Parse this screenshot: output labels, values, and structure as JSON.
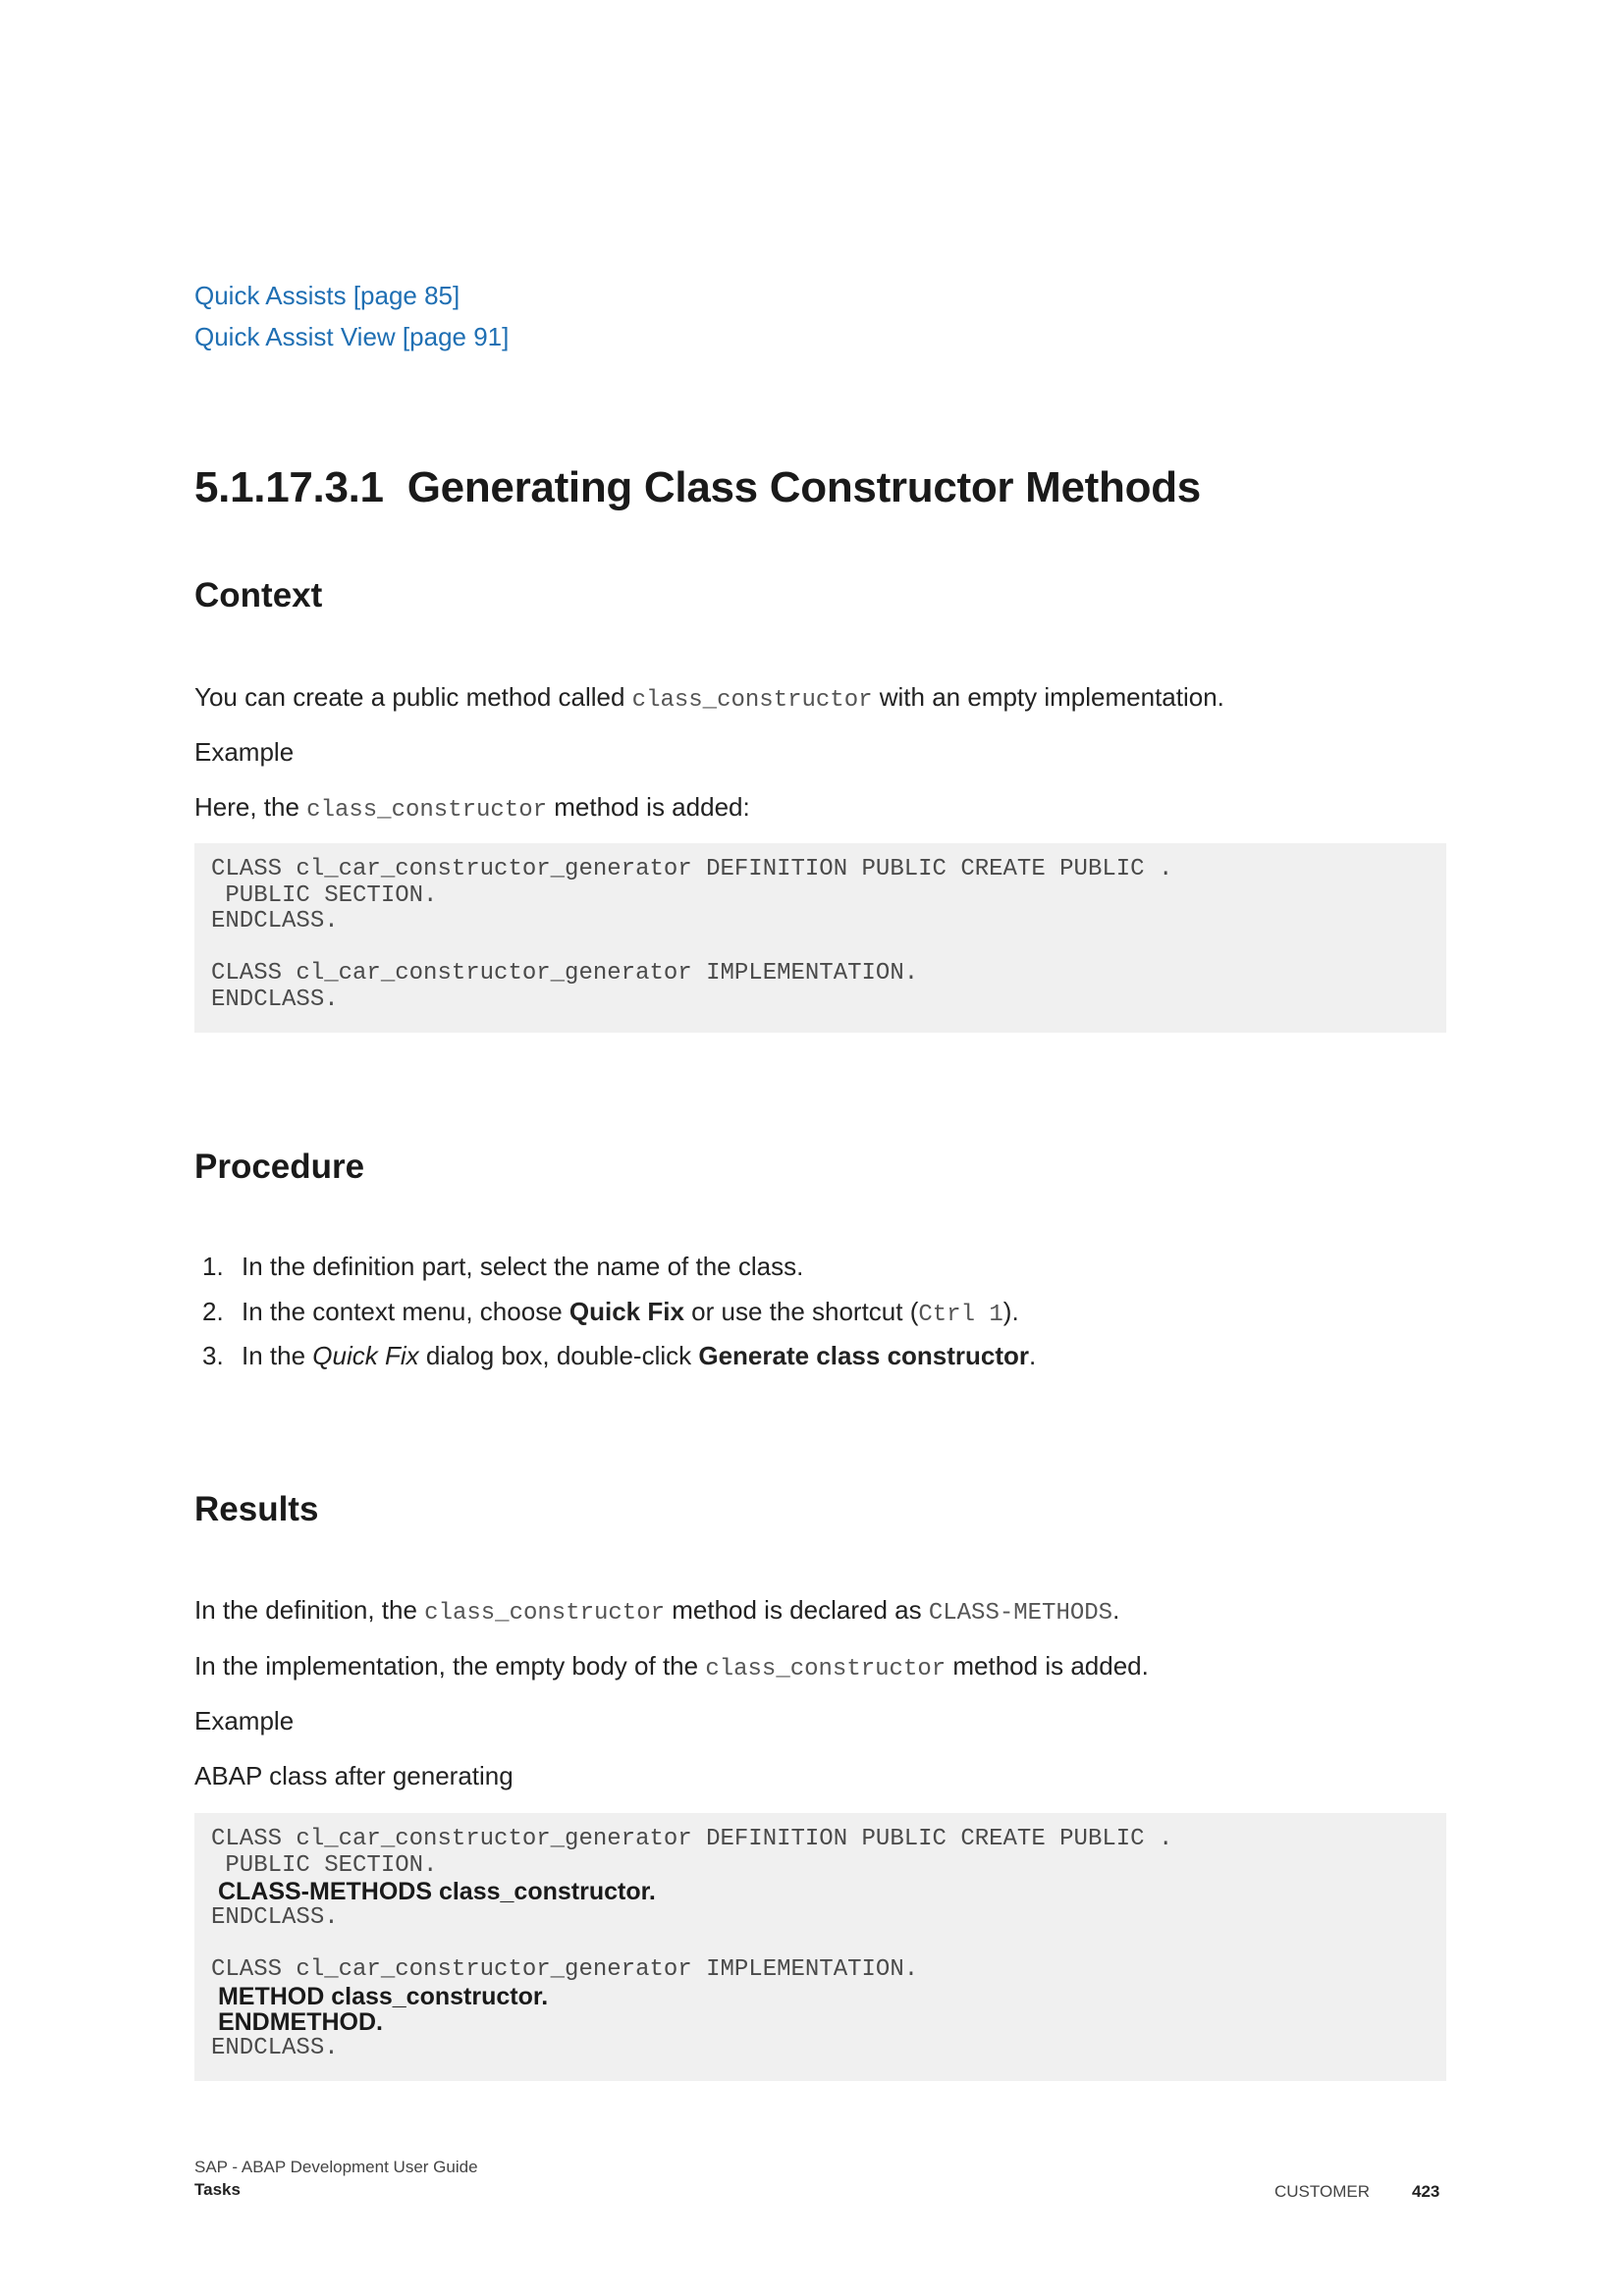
{
  "related_links": [
    "Quick Assists [page 85]",
    "Quick Assist View [page 91]"
  ],
  "section": {
    "number": "5.1.17.3.1",
    "title": "Generating Class Constructor Methods"
  },
  "context": {
    "heading": "Context",
    "intro_pre": "You can create a public method called ",
    "intro_code": "class_constructor",
    "intro_post": " with an empty implementation.",
    "example_label": "Example",
    "example_pre": "Here, the ",
    "example_code": "class_constructor",
    "example_post": " method is added:",
    "code_lines": [
      "CLASS cl_car_constructor_generator DEFINITION PUBLIC CREATE PUBLIC .",
      " PUBLIC SECTION.",
      "ENDCLASS.",
      "",
      "CLASS cl_car_constructor_generator IMPLEMENTATION.",
      "ENDCLASS."
    ]
  },
  "procedure": {
    "heading": "Procedure",
    "steps": [
      {
        "num": "1.",
        "text": "In the definition part, select the name of the class."
      },
      {
        "num": "2.",
        "pre": "In the context menu, choose ",
        "bold": "Quick Fix",
        "mid": " or use the shortcut (",
        "code": "Ctrl 1",
        "post": ")."
      },
      {
        "num": "3.",
        "pre": "In the ",
        "italic": "Quick Fix",
        "mid": " dialog box, double-click ",
        "bold": "Generate class constructor",
        "post": "."
      }
    ]
  },
  "results": {
    "heading": "Results",
    "line1_pre": "In the definition, the ",
    "line1_code": "class_constructor",
    "line1_mid": " method is declared as ",
    "line1_code2": "CLASS-METHODS",
    "line1_post": ".",
    "line2_pre": "In the implementation, the empty body of the ",
    "line2_code": "class_constructor",
    "line2_post": " method is added.",
    "example_label": "Example",
    "example_caption": "ABAP class after generating",
    "code_lines": [
      "CLASS cl_car_constructor_generator DEFINITION PUBLIC CREATE PUBLIC .",
      " PUBLIC SECTION.",
      " CLASS-METHODS class_constructor.",
      "ENDCLASS.",
      "",
      "CLASS cl_car_constructor_generator IMPLEMENTATION.",
      " METHOD class_constructor.",
      " ENDMETHOD.",
      "ENDCLASS."
    ]
  },
  "footer": {
    "doc_title": "SAP - ABAP Development User Guide",
    "chapter": "Tasks",
    "classification": "CUSTOMER",
    "page_number": "423"
  }
}
